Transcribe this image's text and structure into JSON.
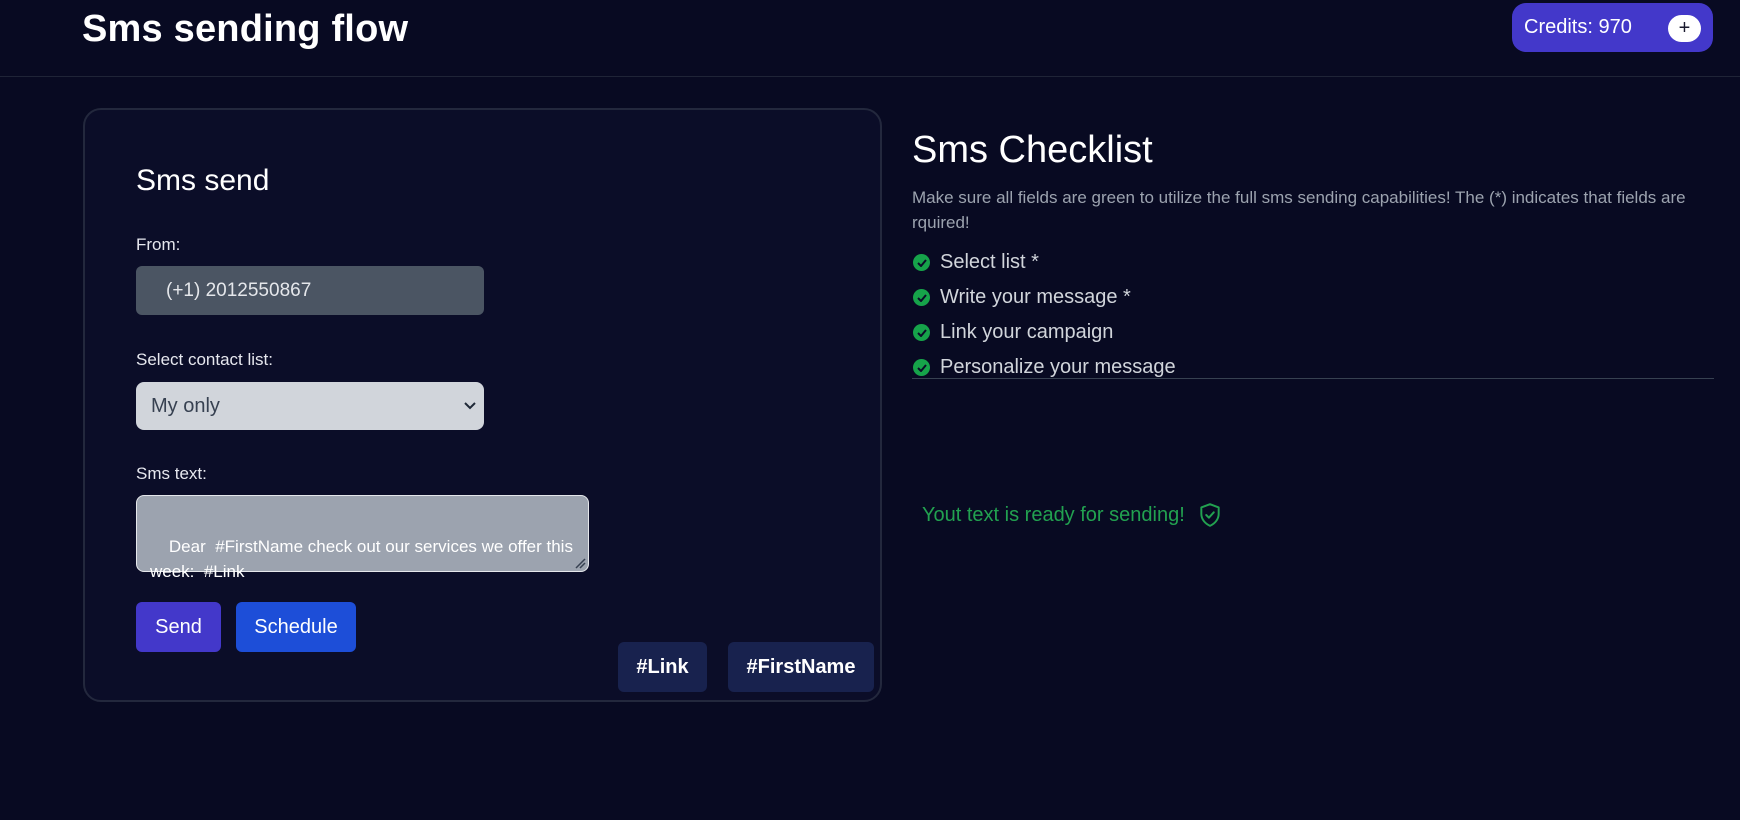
{
  "header": {
    "title": "Sms sending flow",
    "credits_label": "Credits: 970",
    "add_credits_symbol": "+"
  },
  "sms_form": {
    "title": "Sms send",
    "from_label": "From:",
    "from_value": "(+1) 2012550867",
    "contact_list_label": "Select contact list:",
    "contact_list_selected": "My only",
    "sms_text_label": "Sms text:",
    "sms_text_value": "Dear  #FirstName check out our services we offer this week:  #Link",
    "send_label": "Send",
    "schedule_label": "Schedule",
    "tag_link_label": "#Link",
    "tag_firstname_label": "#FirstName"
  },
  "checklist": {
    "title": "Sms Checklist",
    "description": "Make sure all fields are green to utilize the full sms sending capabilities! The (*) indicates that fields are rquired!",
    "items": [
      {
        "label": "Select list *",
        "done": true
      },
      {
        "label": "Write your message *",
        "done": true
      },
      {
        "label": "Link your campaign",
        "done": true
      },
      {
        "label": "Personalize your message",
        "done": true
      }
    ],
    "ready_message": "Yout text is ready for sending!"
  },
  "colors": {
    "background": "#080a22",
    "accent_purple": "#4338ca",
    "accent_blue": "#1d4ed8",
    "success_green": "#16a34a"
  },
  "icons": [
    "check-circle-icon",
    "shield-check-icon",
    "chevron-down-icon",
    "plus-icon"
  ]
}
